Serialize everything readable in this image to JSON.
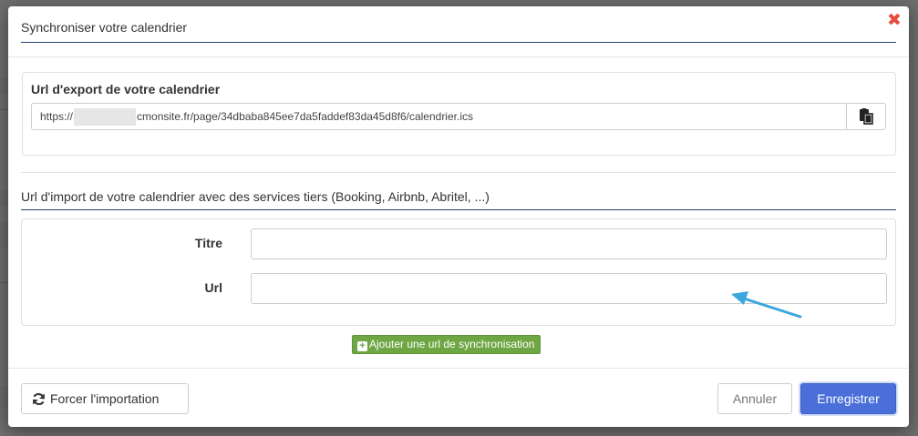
{
  "dialog": {
    "title": "Synchroniser votre calendrier",
    "close_symbol": "✖"
  },
  "export": {
    "label": "Url d'export de votre calendrier",
    "url_prefix": "https://",
    "url_suffix": "cmonsite.fr/page/34dbaba845ee7da5faddef83da45d8f6/calendrier.ics",
    "copy_icon": "clipboard-icon"
  },
  "import": {
    "title": "Url d'import de votre calendrier avec des services tiers (Booking, Airbnb, Abritel, ...)",
    "title_field_label": "Titre",
    "title_field_value": "",
    "url_field_label": "Url",
    "url_field_value": "",
    "add_button_label": "Ajouter une url de synchronisation"
  },
  "footer": {
    "force_import_label": "Forcer l'importation",
    "cancel_label": "Annuler",
    "save_label": "Enregistrer"
  },
  "colors": {
    "accent_blue": "#4a6fd8",
    "add_green": "#6ea644",
    "close_red": "#e74c3c",
    "annotation_arrow": "#3aa7e0"
  }
}
